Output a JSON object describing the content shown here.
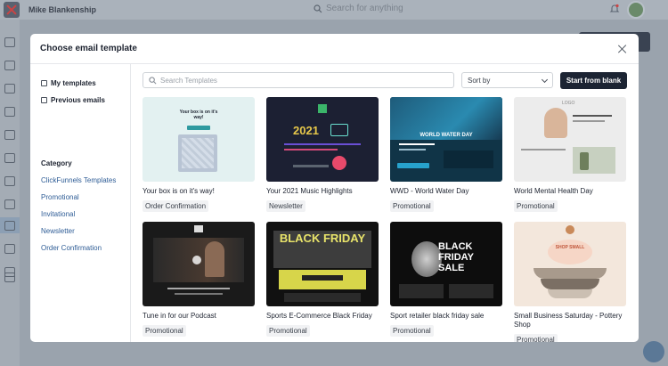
{
  "app": {
    "user_name": "Mike Blankenship",
    "search_placeholder": "Search for anything"
  },
  "modal": {
    "title": "Choose email template",
    "nav": [
      {
        "label": "My templates",
        "icon": "folder-icon"
      },
      {
        "label": "Previous emails",
        "icon": "mail-icon"
      }
    ],
    "category_title": "Category",
    "categories": [
      "ClickFunnels Templates",
      "Promotional",
      "Invitational",
      "Newsletter",
      "Order Confirmation"
    ],
    "search_placeholder": "Search Templates",
    "sort_label": "Sort by",
    "start_button": "Start from blank",
    "templates": [
      {
        "title": "Your box is on it's way!",
        "tag": "Order Confirmation",
        "thumb_text": "Your box is on it's way!"
      },
      {
        "title": "Your 2021 Music Highlights",
        "tag": "Newsletter",
        "thumb_text": "2021"
      },
      {
        "title": "WWD - World Water Day",
        "tag": "Promotional",
        "thumb_text": "WORLD WATER DAY"
      },
      {
        "title": "World Mental Health Day",
        "tag": "Promotional",
        "thumb_text": "LOGO"
      },
      {
        "title": "Tune in for our Podcast",
        "tag": "Promotional",
        "thumb_text": ""
      },
      {
        "title": "Sports E-Commerce Black Friday",
        "tag": "Promotional",
        "thumb_text": "BLACK FRIDAY"
      },
      {
        "title": "Sport retailer black friday sale",
        "tag": "Promotional",
        "thumb_text": "BLACK FRIDAY SALE"
      },
      {
        "title": "Small Business Saturday - Pottery Shop",
        "tag": "Promotional",
        "thumb_text": "SHOP SMALL"
      }
    ]
  }
}
